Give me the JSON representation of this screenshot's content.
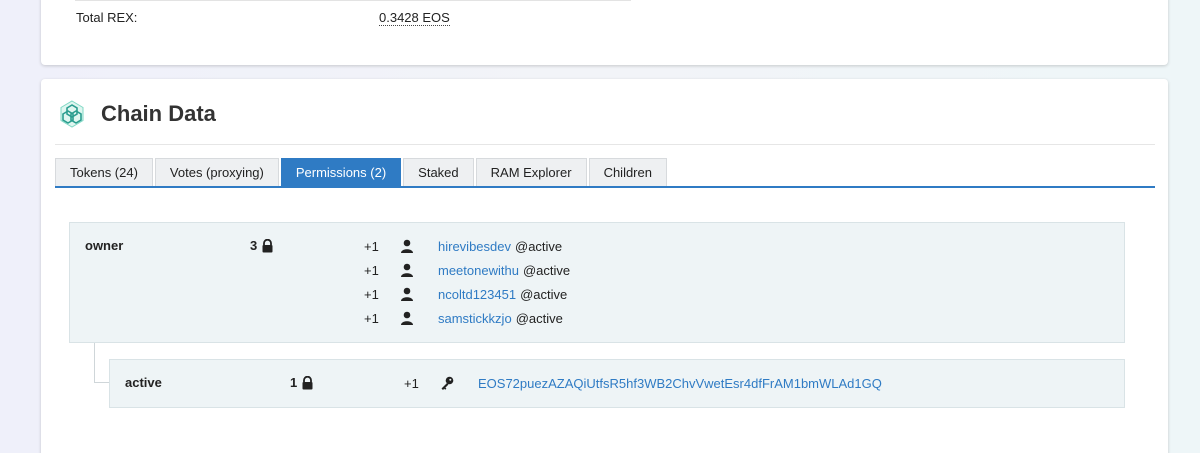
{
  "rex": {
    "label": "Total REX:",
    "value": "0.3428 EOS"
  },
  "section": {
    "title": "Chain Data",
    "icon": "chain-data-icon"
  },
  "tabs": [
    {
      "label": "Tokens (24)",
      "active": false
    },
    {
      "label": "Votes (proxying)",
      "active": false
    },
    {
      "label": "Permissions (2)",
      "active": true
    },
    {
      "label": "Staked",
      "active": false
    },
    {
      "label": "RAM Explorer",
      "active": false
    },
    {
      "label": "Children",
      "active": false
    }
  ],
  "permissions": [
    {
      "name": "owner",
      "threshold": "3",
      "entries": [
        {
          "weight": "+1",
          "type": "account",
          "account": "hirevibesdev",
          "permission": "@active"
        },
        {
          "weight": "+1",
          "type": "account",
          "account": "meetonewithu",
          "permission": "@active"
        },
        {
          "weight": "+1",
          "type": "account",
          "account": "ncoltd123451",
          "permission": "@active"
        },
        {
          "weight": "+1",
          "type": "account",
          "account": "samstickkzjo",
          "permission": "@active"
        }
      ]
    },
    {
      "name": "active",
      "threshold": "1",
      "entries": [
        {
          "weight": "+1",
          "type": "key",
          "key": "EOS72puezAZAQiUtfsR5hf3WB2ChvVwetEsr4dfFrAM1bmWLAd1GQ"
        }
      ]
    }
  ],
  "colors": {
    "accent": "#2f7bc4",
    "panel": "#eef4f6"
  }
}
